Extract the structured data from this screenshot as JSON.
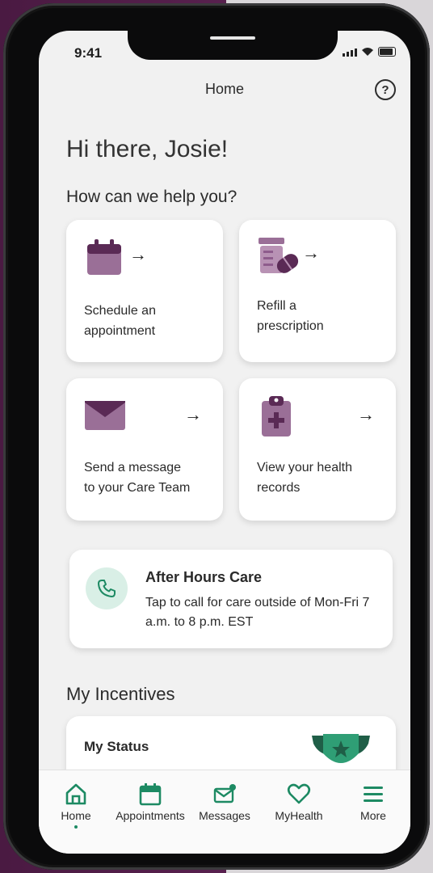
{
  "status_bar": {
    "time": "9:41"
  },
  "header": {
    "title": "Home",
    "help_icon": "question-circle-icon"
  },
  "greeting": "Hi there, Josie!",
  "help_heading": "How can we help you?",
  "actions": [
    {
      "label": "Schedule an\nappointment",
      "icon": "calendar-icon",
      "arrow": "→"
    },
    {
      "label": "Refill a\nprescription",
      "icon": "pill-bottle-icon",
      "arrow": "→"
    },
    {
      "label": "Send a message\nto your Care Team",
      "icon": "envelope-icon",
      "arrow": "→"
    },
    {
      "label": "View your health\nrecords",
      "icon": "clipboard-medical-icon",
      "arrow": "→"
    }
  ],
  "after_hours": {
    "title": "After Hours Care",
    "description": "Tap to call for care outside of Mon-Fri 7 a.m. to 8 p.m. EST",
    "icon": "phone-icon"
  },
  "incentives": {
    "heading": "My Incentives",
    "status_title": "My Status",
    "trophy_icon": "trophy-icon"
  },
  "tabs": [
    {
      "label": "Home",
      "icon": "home-icon",
      "active": true
    },
    {
      "label": "Appointments",
      "icon": "calendar-icon",
      "active": false
    },
    {
      "label": "Messages",
      "icon": "message-icon",
      "active": false
    },
    {
      "label": "MyHealth",
      "icon": "heart-icon",
      "active": false
    },
    {
      "label": "More",
      "icon": "menu-icon",
      "active": false
    }
  ],
  "colors": {
    "accent_purple": "#8e5c8c",
    "accent_green": "#1d8a63",
    "background": "#f1f1f1"
  }
}
